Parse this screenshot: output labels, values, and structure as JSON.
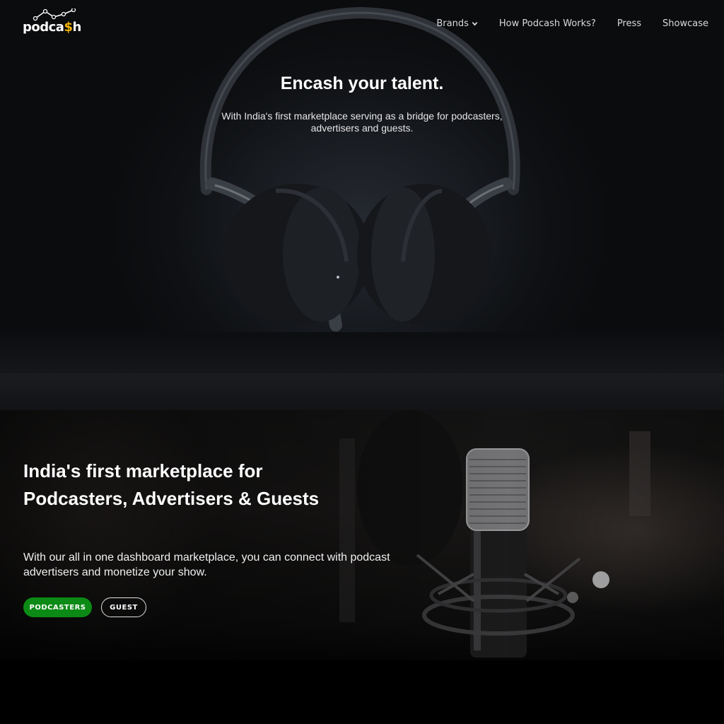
{
  "brand": {
    "logo_prefix": "podca",
    "logo_dollar": "$",
    "logo_suffix": "h",
    "accent_color": "#f4b400"
  },
  "nav": {
    "items": [
      {
        "label": "Brands",
        "has_dropdown": true
      },
      {
        "label": "How Podcash Works?"
      },
      {
        "label": "Press"
      },
      {
        "label": "Showcase"
      }
    ]
  },
  "hero": {
    "title": "Encash your talent.",
    "subtitle": "With India's first marketplace serving as a bridge for podcasters, advertisers and guests."
  },
  "marketplace": {
    "title": "India's first marketplace for Podcasters, Advertisers & Guests",
    "description": "With our all in one dashboard marketplace, you can connect with podcast advertisers and monetize your show.",
    "primary_button": "PODCASTERS",
    "secondary_button": "GUEST",
    "primary_color": "#0b8a16"
  },
  "icons": {
    "dropdown": "chevron-down-icon",
    "logo_graph": "line-graph-icon"
  }
}
